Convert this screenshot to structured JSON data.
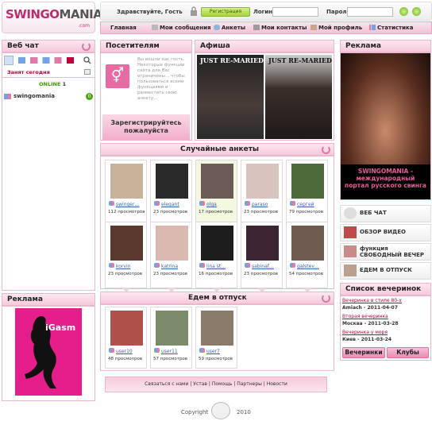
{
  "logo": {
    "brand_a": "SWINGO",
    "brand_b": "MANIA",
    "domain": ".com"
  },
  "topbar": {
    "greeting": "Здравствуйте, Гость",
    "register": "Регистрация",
    "login_label": "Логин",
    "password_label": "Пароль"
  },
  "nav": [
    {
      "label": "Главная",
      "icon": "home-icon"
    },
    {
      "label": "Мои сообщения",
      "icon": "mail-icon"
    },
    {
      "label": "Анкеты",
      "icon": "chat-icon"
    },
    {
      "label": "Мои контакты",
      "icon": "contacts-icon"
    },
    {
      "label": "Мой профиль",
      "icon": "profile-icon"
    },
    {
      "label": "Статистика",
      "icon": "stats-icon"
    }
  ],
  "webchat": {
    "title": "Веб чат",
    "busy": "Занят сегодня",
    "online_label": "ONLINE",
    "online_count": "1",
    "user": "swingomania",
    "user_badge": "0"
  },
  "visitors": {
    "title": "Посетителям",
    "text": "Вы вошли как гость. Некоторые функции сайта для Вас ограничены… чтобы пользоваться всеми функциями и разместить свою анкету…",
    "guest_word": "гость",
    "register_cta": "Зарегистрируйтесь пожалуйста"
  },
  "afisha": {
    "title": "Афиша",
    "poster_title": "JUST RE-MARIED"
  },
  "ads_right": {
    "title": "Реклама",
    "caption": "SWINGOMANIA - международный портал русского свинга"
  },
  "random": {
    "title": "Случайные анкеты",
    "cards": [
      {
        "name": "swinger…",
        "views": "112 просмотров"
      },
      {
        "name": "elegant",
        "views": "23 просмотров"
      },
      {
        "name": "olga",
        "views": "17 просмотров"
      },
      {
        "name": "paraso",
        "views": "23 просмотров"
      },
      {
        "name": "сергей",
        "views": "79 просмотров"
      },
      {
        "name": "korvin",
        "views": "23 просмотров"
      },
      {
        "name": "katrina",
        "views": "23 просмотров"
      },
      {
        "name": "lina st…",
        "views": "16 просмотров"
      },
      {
        "name": "sabinaf…",
        "views": "23 просмотров"
      },
      {
        "name": "galstev…",
        "views": "54 просмотров"
      }
    ]
  },
  "vacation": {
    "title": "Едем в отпуск",
    "cards": [
      {
        "name": "user10",
        "views": "48 просмотров"
      },
      {
        "name": "user11",
        "views": "57 просмотров"
      },
      {
        "name": "user7",
        "views": "59 просмотров"
      }
    ]
  },
  "side_buttons": [
    {
      "label": "ВЕБ ЧАТ",
      "icon": "webcam-icon"
    },
    {
      "label": "ОБЗОР ВИДЕО",
      "icon": "video-icon"
    },
    {
      "label": "функция СВОБОДНЫЙ ВЕЧЕР",
      "icon": "free-evening-icon"
    },
    {
      "label": "ЕДЕМ В ОТПУСК",
      "icon": "vacation-icon"
    }
  ],
  "parties": {
    "title": "Список вечеринок",
    "items": [
      {
        "name": "Вечеринка в стиле 80-х",
        "info": "Amiach - 2011-04-07"
      },
      {
        "name": "Вторая вечеринка",
        "info": "Москва - 2011-03-28"
      },
      {
        "name": "Вечеринка у моря",
        "info": "Киев - 2011-03-24"
      }
    ],
    "btn_parties": "Вечеринки",
    "btn_clubs": "Клубы"
  },
  "ads_left": {
    "title": "Реклама",
    "banner": "iGasm"
  },
  "footer": {
    "links": [
      "Связаться с нами",
      "Устав",
      "Помощь",
      "Партнеры",
      "Новости"
    ],
    "copyright": "Copyright",
    "year": "2010"
  }
}
